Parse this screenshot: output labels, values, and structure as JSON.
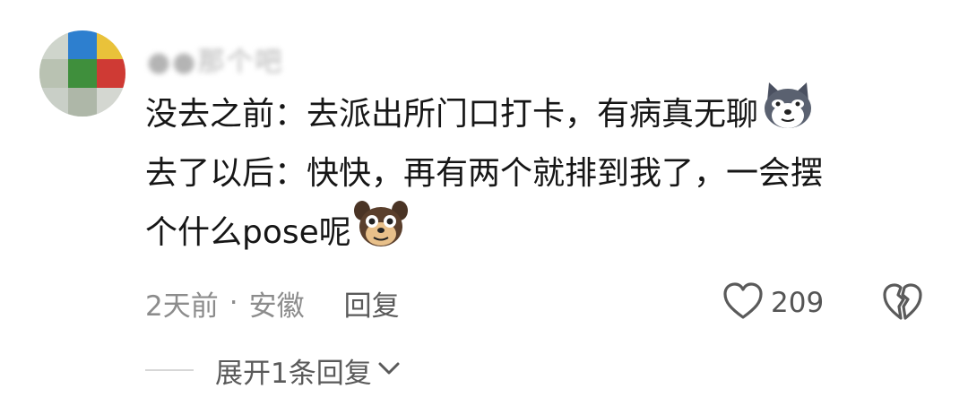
{
  "comment": {
    "username": "●●那个吧",
    "lines": [
      "没去之前：去派出所门口打卡，有病真无聊",
      "去了以后：快快，再有两个就排到我了，一会摆",
      "个什么pose呢"
    ],
    "emoji_1": "husky-emoji-icon",
    "emoji_2": "puppy-emoji-icon"
  },
  "meta": {
    "time": "2天前",
    "separator": "·",
    "location": "安徽",
    "reply_label": "回复"
  },
  "actions": {
    "like_count": "209"
  },
  "expand": {
    "label": "展开1条回复"
  },
  "colors": {
    "text": "#161616",
    "muted": "#8c8c8c",
    "secondary": "#5a5a5a"
  }
}
